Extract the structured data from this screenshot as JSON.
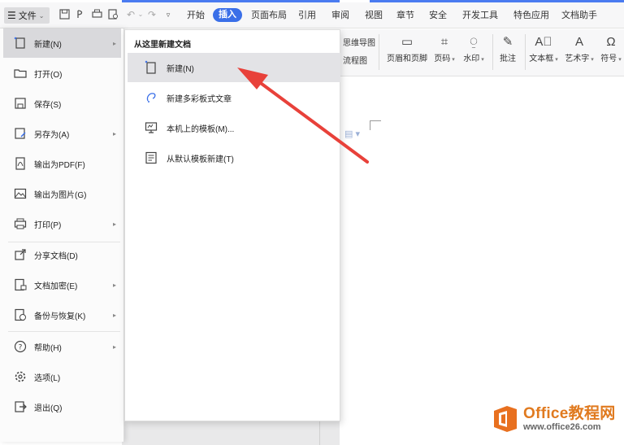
{
  "topbar": {
    "file_label": "文件",
    "tabs": [
      {
        "label": "开始"
      },
      {
        "label": "插入",
        "active": true
      },
      {
        "label": "页面布局"
      },
      {
        "label": "引用"
      },
      {
        "label": "审阅"
      },
      {
        "label": "视图"
      },
      {
        "label": "章节"
      },
      {
        "label": "安全"
      },
      {
        "label": "开发工具"
      },
      {
        "label": "特色应用"
      },
      {
        "label": "文档助手"
      }
    ]
  },
  "ribbon": {
    "mindmap": "思维导图",
    "flowchart": "流程图",
    "header_footer": "页眉和页脚",
    "page_number": "页码",
    "watermark": "水印",
    "comment": "批注",
    "textbox": "文本框",
    "wordart": "艺术字",
    "symbol": "符号"
  },
  "file_menu": {
    "items": [
      {
        "label": "新建(N)",
        "icon": "new-doc-icon"
      },
      {
        "label": "打开(O)",
        "icon": "folder-icon"
      },
      {
        "label": "保存(S)",
        "icon": "save-icon"
      },
      {
        "label": "另存为(A)",
        "icon": "save-as-icon"
      },
      {
        "label": "输出为PDF(F)",
        "icon": "pdf-icon"
      },
      {
        "label": "输出为图片(G)",
        "icon": "image-icon"
      },
      {
        "label": "打印(P)",
        "icon": "print-icon"
      },
      {
        "label": "分享文档(D)",
        "icon": "share-icon"
      },
      {
        "label": "文档加密(E)",
        "icon": "encrypt-icon"
      },
      {
        "label": "备份与恢复(K)",
        "icon": "backup-icon"
      },
      {
        "label": "帮助(H)",
        "icon": "help-icon"
      },
      {
        "label": "选项(L)",
        "icon": "gear-icon"
      },
      {
        "label": "退出(Q)",
        "icon": "exit-icon"
      }
    ]
  },
  "submenu": {
    "title": "从这里新建文档",
    "items": [
      {
        "label": "新建(N)",
        "icon": "new-blank-icon"
      },
      {
        "label": "新建多彩板式文章",
        "icon": "colorful-article-icon"
      },
      {
        "label": "本机上的模板(M)...",
        "icon": "local-template-icon"
      },
      {
        "label": "从默认模板新建(T)",
        "icon": "default-template-icon"
      }
    ]
  },
  "watermark": {
    "brand": "Office教程网",
    "url": "www.office26.com"
  },
  "colors": {
    "accent": "#3a6fe8",
    "arrow": "#e8413a",
    "brand_orange": "#e07a1f"
  }
}
